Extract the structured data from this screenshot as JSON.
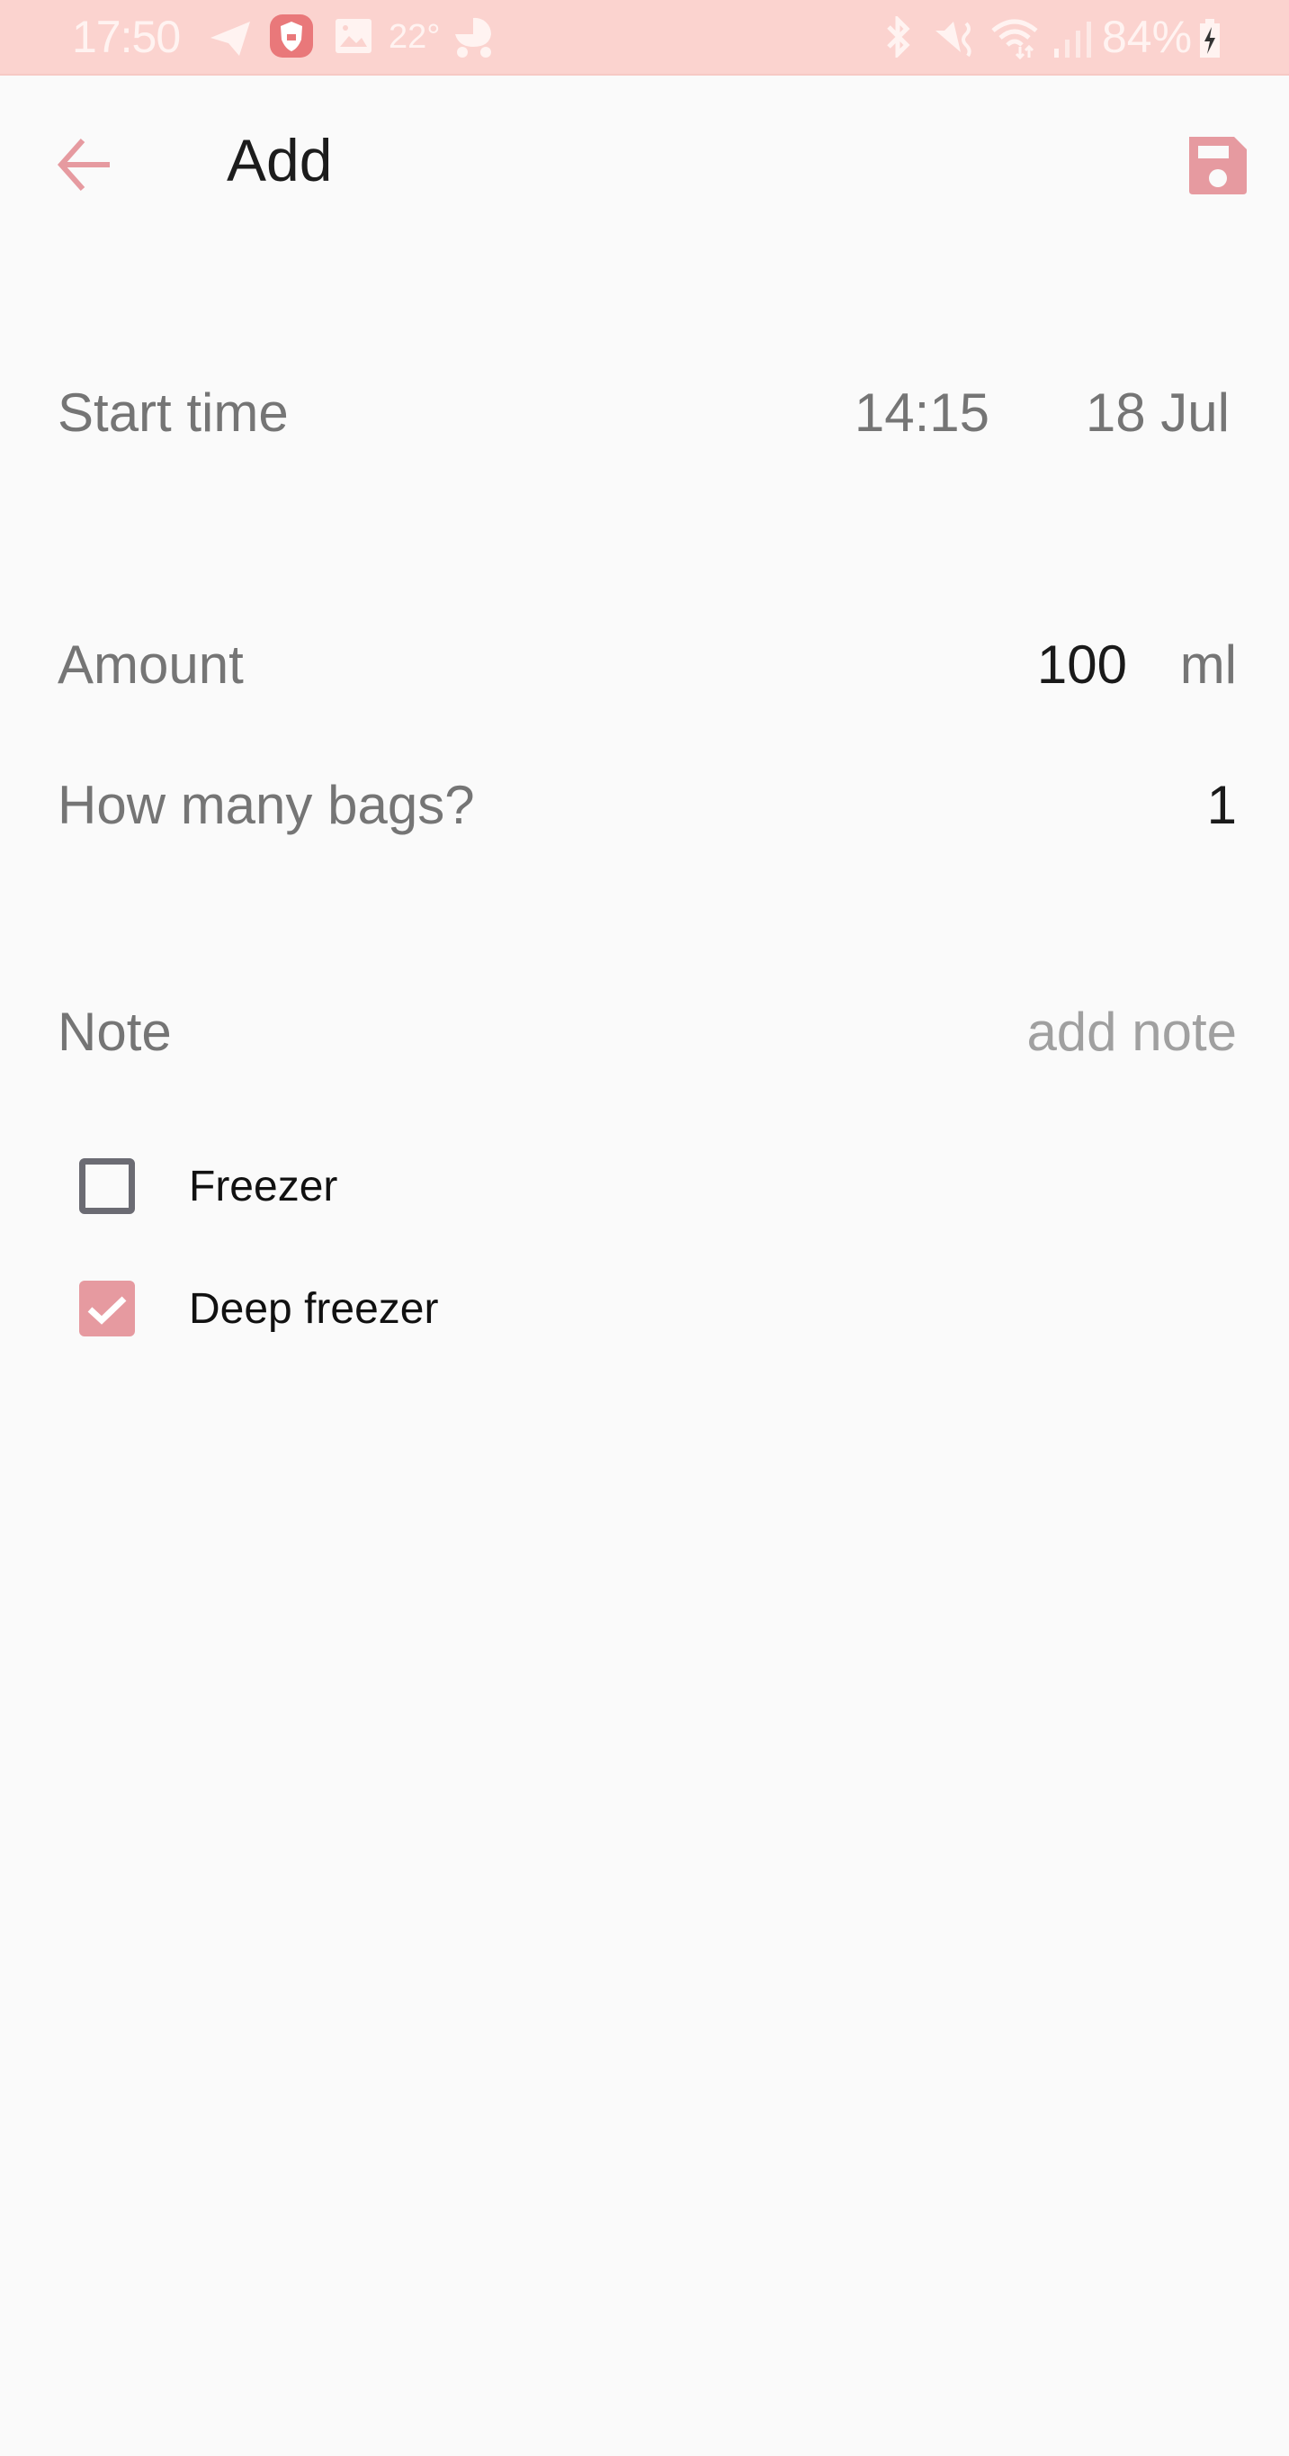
{
  "status_bar": {
    "time": "17:50",
    "temperature": "22°",
    "battery": "84%",
    "icons": [
      "telegram-icon",
      "shield-app-icon",
      "gallery-icon",
      "baby-stroller-icon",
      "bluetooth-icon",
      "mute-vibrate-icon",
      "wifi-icon",
      "signal-icon",
      "battery-charging-icon"
    ]
  },
  "app_bar": {
    "title": "Add",
    "back_icon": "arrow-back-icon",
    "save_icon": "floppy-save-icon"
  },
  "form": {
    "start_time": {
      "label": "Start time",
      "time": "14:15",
      "date": "18 Jul"
    },
    "amount": {
      "label": "Amount",
      "value": "100",
      "unit": "ml"
    },
    "bags": {
      "label": "How many bags?",
      "value": "1"
    },
    "note": {
      "label": "Note",
      "placeholder": "add note",
      "value": ""
    },
    "storage": [
      {
        "label": "Freezer",
        "checked": false
      },
      {
        "label": "Deep freezer",
        "checked": true
      }
    ]
  },
  "colors": {
    "accent": "#e69aa0",
    "status_bar": "#fbd3cf",
    "background": "#fafafa"
  }
}
